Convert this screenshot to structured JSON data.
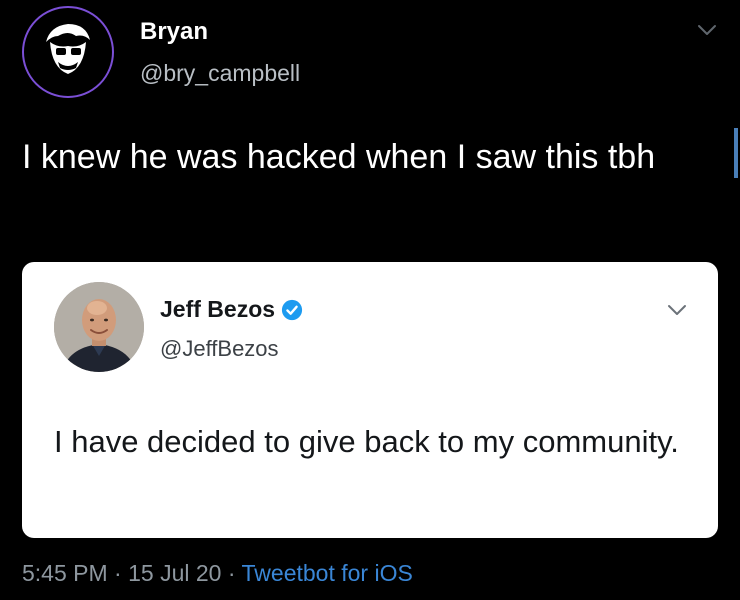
{
  "tweet": {
    "author": {
      "name": "Bryan",
      "handle": "@bry_campbell",
      "avatar_icon": "cartoon-face-avatar-icon",
      "avatar_ring_color": "#7b4fd6"
    },
    "text": "I knew he was hacked when I saw this tbh",
    "quoted": {
      "author": {
        "name": "Jeff Bezos",
        "handle": "@JeffBezos",
        "verified": true,
        "avatar_icon": "profile-photo-avatar"
      },
      "text": "I have decided to give back to my community."
    },
    "meta": {
      "time": "5:45 PM",
      "separator": "·",
      "date": "15 Jul 20",
      "client": "Tweetbot for iOS"
    }
  },
  "colors": {
    "background": "#000000",
    "link": "#3a86d6",
    "verified": "#1d9bf0",
    "muted": "#8e979f"
  }
}
